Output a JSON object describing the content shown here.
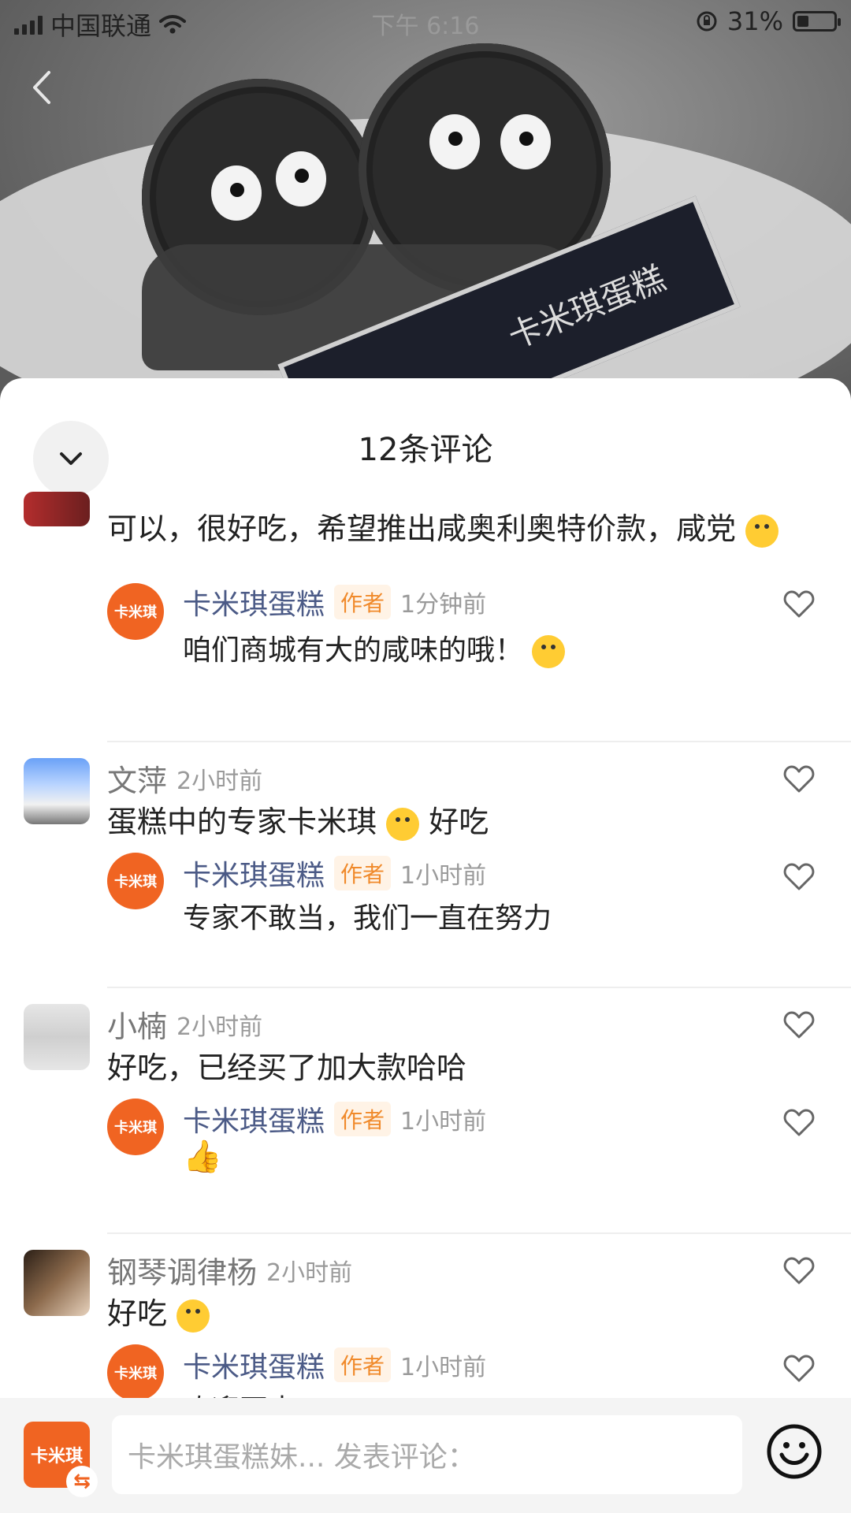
{
  "status_bar": {
    "carrier": "中国联通",
    "time": "下午 6:16",
    "battery_text": "31%",
    "battery_level_percent": 31
  },
  "photo": {
    "brand_label": "卡米琪蛋糕"
  },
  "sheet": {
    "title": "12条评论"
  },
  "comments": [
    {
      "name": "",
      "time": "",
      "text": "可以，很好吃，希望推出咸奥利奥特价款，咸党",
      "reply": {
        "name": "卡米琪蛋糕",
        "badge": "作者",
        "time": "1分钟前",
        "text": "咱们商城有大的咸味的哦！",
        "logo_text": "卡米琪"
      }
    },
    {
      "name": "文萍",
      "time": "2小时前",
      "text": "蛋糕中的专家卡米琪",
      "text_suffix": "好吃",
      "reply": {
        "name": "卡米琪蛋糕",
        "badge": "作者",
        "time": "1小时前",
        "text": "专家不敢当，我们一直在努力",
        "logo_text": "卡米琪"
      }
    },
    {
      "name": "小楠",
      "time": "2小时前",
      "text": "好吃，已经买了加大款哈哈",
      "reply": {
        "name": "卡米琪蛋糕",
        "badge": "作者",
        "time": "1小时前",
        "text": "",
        "logo_text": "卡米琪"
      }
    },
    {
      "name": "钢琴调律杨",
      "time": "2小时前",
      "text": "好吃",
      "reply": {
        "name": "卡米琪蛋糕",
        "badge": "作者",
        "time": "1小时前",
        "text": "欢迎再来",
        "logo_text": "卡米琪"
      }
    }
  ],
  "composer": {
    "avatar_text": "卡米琪",
    "swap_icon": "⇆",
    "placeholder": "卡米琪蛋糕妹... 发表评论："
  },
  "icons": {
    "like": "heart-outline-icon",
    "emoji": "smile-icon",
    "collapse": "chevron-down-icon",
    "back": "chevron-left-icon"
  },
  "colors": {
    "brand_orange": "#f06422",
    "author_name": "#4b5a86",
    "badge_text": "#f08a2b"
  }
}
